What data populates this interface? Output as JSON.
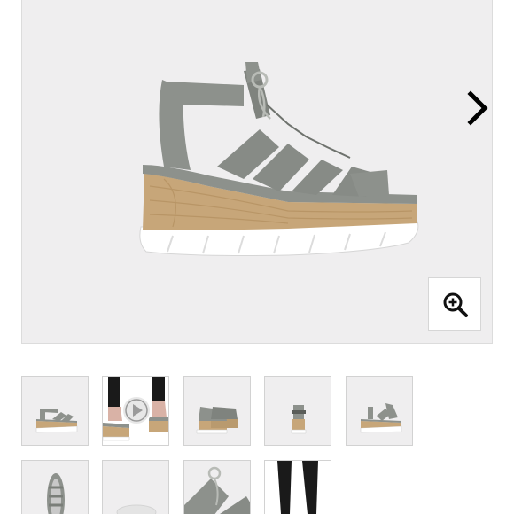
{
  "product_gallery": {
    "main_image": {
      "alt": "",
      "icon": "sandal-image",
      "colors": {
        "strap": "#8d918c",
        "sole": "#c7a679",
        "outsole": "#ffffff",
        "background": "#efeeef"
      }
    },
    "next_control": {
      "icon": "chevron-right-icon"
    },
    "zoom_control": {
      "icon": "zoom-in-icon"
    },
    "thumbnails": [
      {
        "view": "side",
        "has_video": false
      },
      {
        "view": "on-foot",
        "has_video": true
      },
      {
        "view": "pair",
        "has_video": false
      },
      {
        "view": "back",
        "has_video": false
      },
      {
        "view": "angle",
        "has_video": false
      },
      {
        "view": "top",
        "has_video": false
      },
      {
        "view": "sole",
        "has_video": false
      },
      {
        "view": "detail",
        "has_video": false
      },
      {
        "view": "model",
        "has_video": false
      }
    ]
  }
}
